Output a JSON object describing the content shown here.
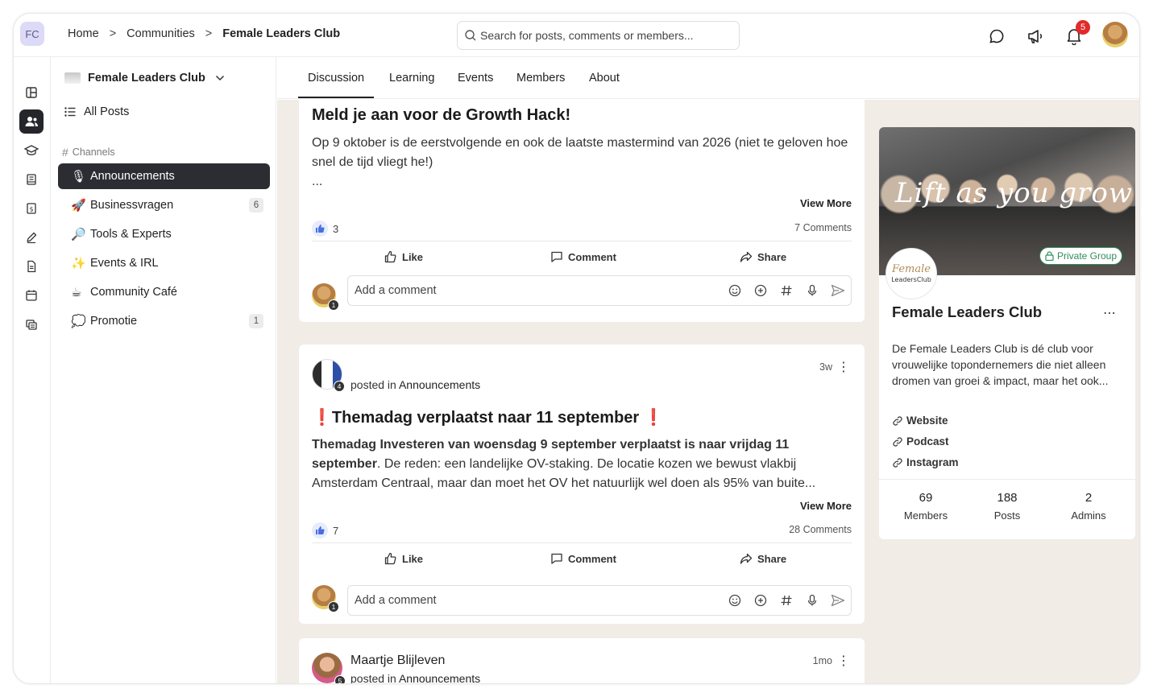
{
  "app": {
    "logo_initials": "FC"
  },
  "breadcrumb": [
    "Home",
    "Communities",
    "Female Leaders Club"
  ],
  "search": {
    "placeholder": "Search for posts, comments or members..."
  },
  "header": {
    "notification_count": "5"
  },
  "sidebar": {
    "community_name": "Female Leaders Club",
    "all_posts_label": "All Posts",
    "channels_label": "Channels",
    "channels": [
      {
        "emoji": "🎙",
        "label": "Announcements",
        "count": ""
      },
      {
        "emoji": "🚀",
        "label": "Businessvragen",
        "count": "6"
      },
      {
        "emoji": "🔎",
        "label": "Tools & Experts",
        "count": ""
      },
      {
        "emoji": "✨",
        "label": "Events & IRL",
        "count": ""
      },
      {
        "emoji": "☕",
        "label": "Community Café",
        "count": ""
      },
      {
        "emoji": "💭",
        "label": "Promotie",
        "count": "1"
      }
    ]
  },
  "tabs": [
    "Discussion",
    "Learning",
    "Events",
    "Members",
    "About"
  ],
  "posts": [
    {
      "title": "Meld je aan voor de Growth Hack!",
      "body": "Op 9 oktober is de eerstvolgende en ook de laatste mastermind van 2026 (niet te geloven hoe snel de tijd vliegt he!)",
      "ellipsis": "...",
      "view_more": "View More",
      "likes": "3",
      "comments": "7 Comments",
      "like_label": "Like",
      "comment_label": "Comment",
      "share_label": "Share",
      "comment_placeholder": "Add a comment",
      "commenter_badge": "1"
    },
    {
      "time": "3w",
      "author_badge": "4",
      "posted_in_prefix": "posted in",
      "channel": "Announcements",
      "title_prefix": "❗",
      "title": "Themadag verplaatst naar 11 september",
      "title_suffix": "❗",
      "body_bold": "Themadag Investeren van woensdag 9 september verplaatst is naar vrijdag 11 september",
      "body_rest": ". De reden: een landelijke OV-staking. De locatie kozen we bewust vlakbij Amsterdam Centraal, maar dan moet het OV het natuurlijk wel doen als 95% van buite...",
      "view_more": "View More",
      "likes": "7",
      "comments": "28 Comments",
      "like_label": "Like",
      "comment_label": "Comment",
      "share_label": "Share",
      "comment_placeholder": "Add a comment",
      "commenter_badge": "1"
    },
    {
      "author": "Maartje Blijleven",
      "time": "1mo",
      "author_badge": "5",
      "posted_in_prefix": "posted in",
      "channel": "Announcements"
    }
  ],
  "group": {
    "cover_text": "Lift as you grow",
    "privacy": "Private Group",
    "logo_text_top": "Female",
    "logo_text_bottom": "LeadersClub",
    "name": "Female Leaders Club",
    "description": "De Female Leaders Club is dé club voor vrouwelijke topondernemers die niet alleen dromen van groei & impact, maar het ook...",
    "links": [
      "Website",
      "Podcast",
      "Instagram"
    ],
    "stats": [
      {
        "value": "69",
        "label": "Members"
      },
      {
        "value": "188",
        "label": "Posts"
      },
      {
        "value": "2",
        "label": "Admins"
      }
    ]
  },
  "colors": {
    "feed_background": "#f1ece6",
    "active_channel": "#2b2d33",
    "notification_badge": "#e12b2b",
    "private_badge": "#2f8f5a",
    "logo_box": "#dcdaf7"
  }
}
